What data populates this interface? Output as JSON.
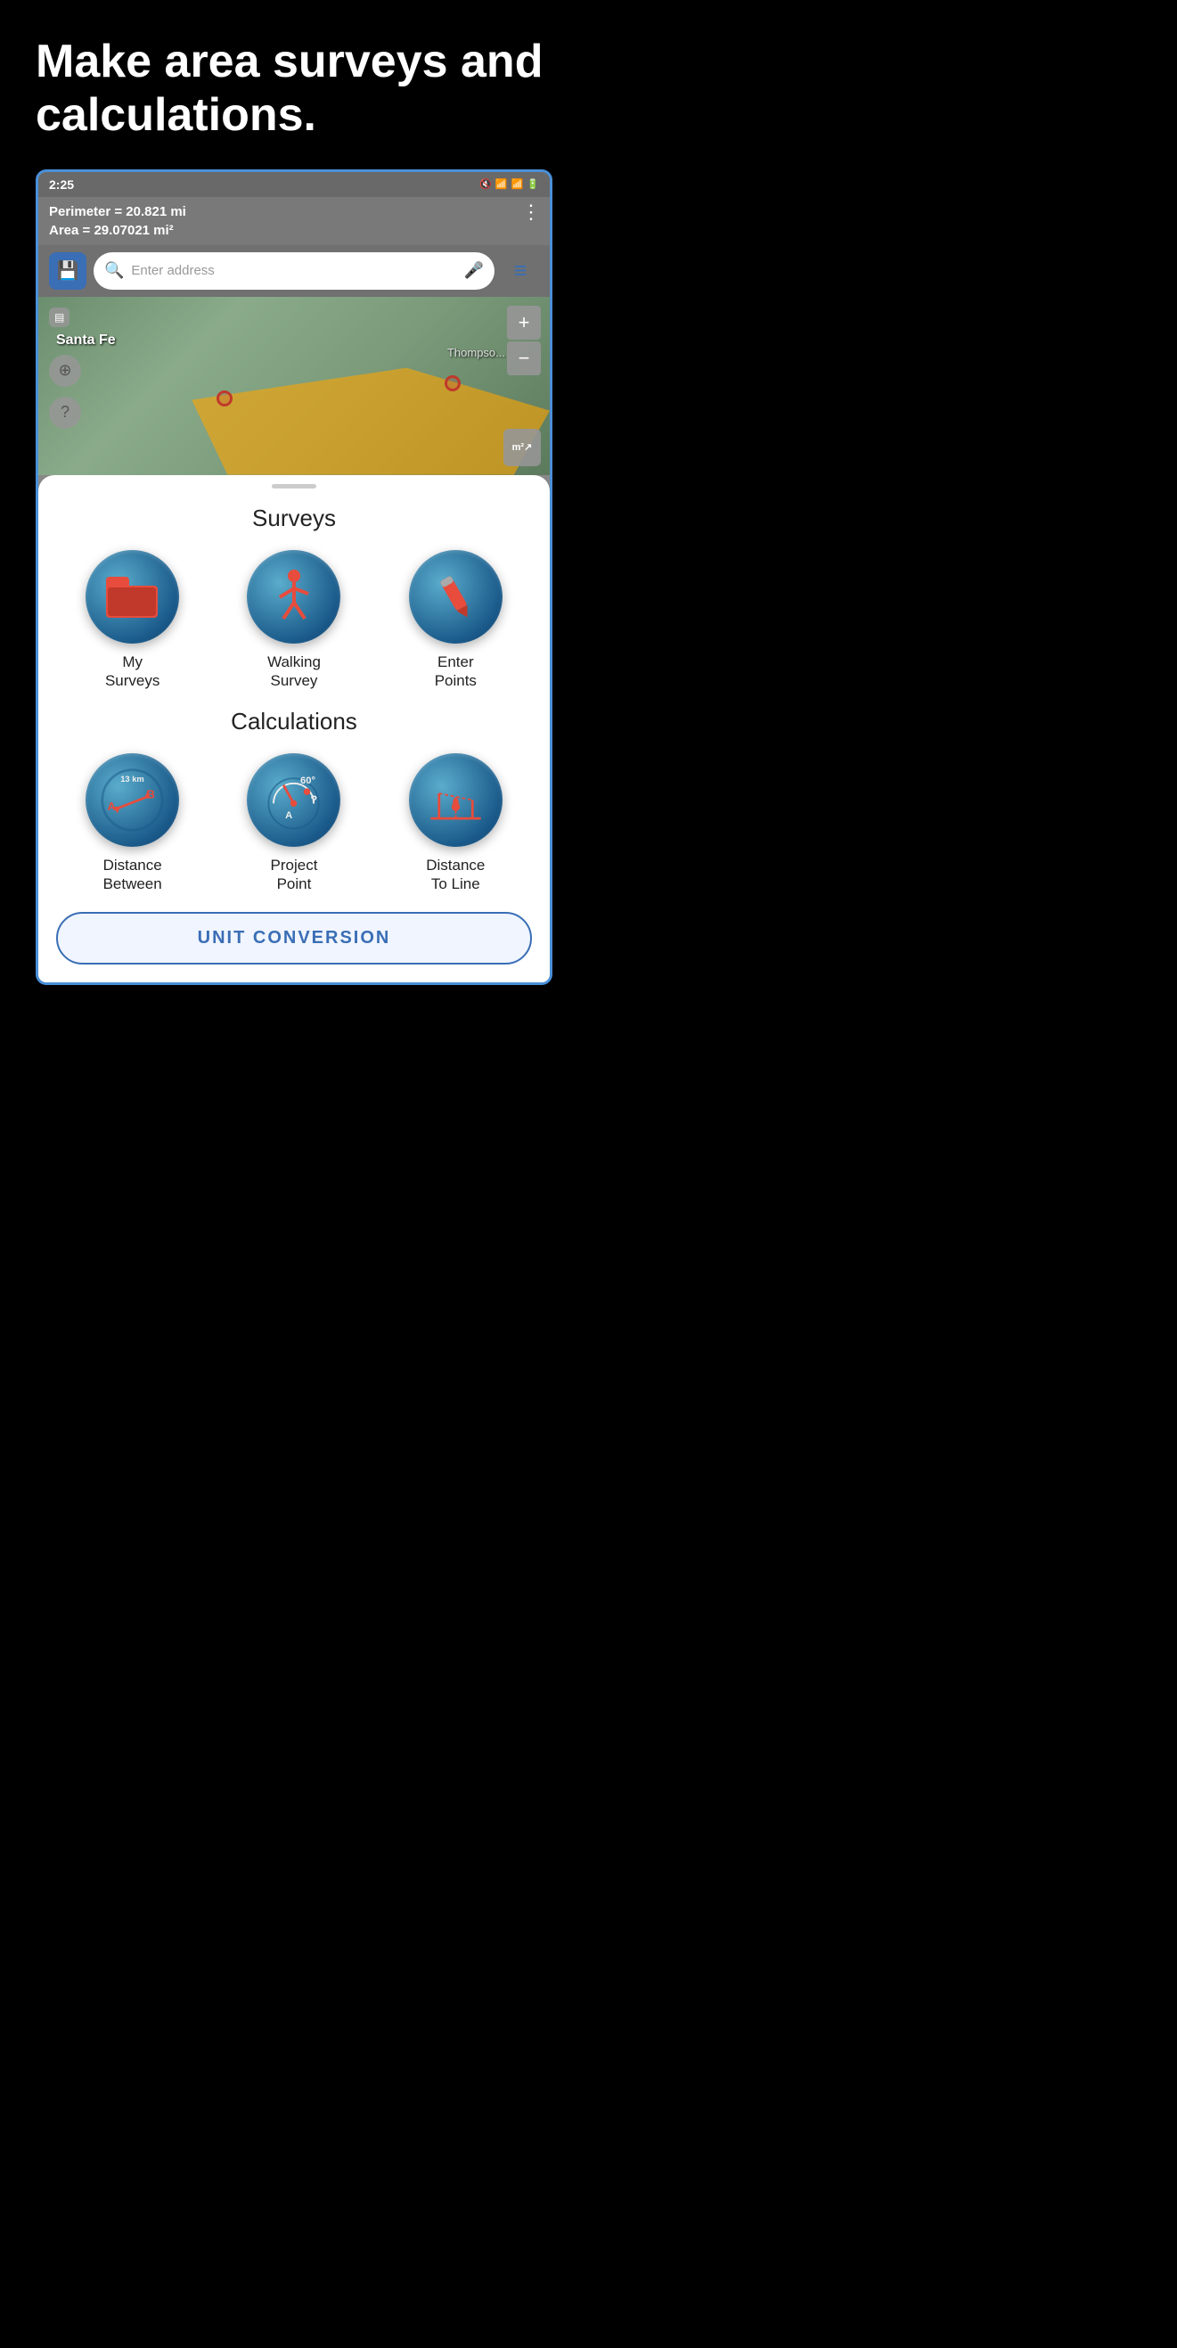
{
  "hero": {
    "title": "Make area surveys and calculations."
  },
  "status_bar": {
    "time": "2:25",
    "icons": "🔇 📶 📶 🔋"
  },
  "info_bar": {
    "perimeter": "Perimeter = 20.821 mi",
    "area": "Area = 29.07021 mi²",
    "more": "⋮"
  },
  "search_bar": {
    "save_icon": "💾",
    "placeholder": "Enter address",
    "mic_icon": "🎤",
    "menu_icon": "☰"
  },
  "map": {
    "label_santa_fe": "Santa Fe",
    "label_thompson": "Thompso...",
    "zoom_in": "+",
    "zoom_out": "−",
    "location_icon": "⊕",
    "help_icon": "?",
    "area_icon": "m²"
  },
  "bottom_sheet": {
    "handle": true,
    "surveys_title": "Surveys",
    "calculations_title": "Calculations",
    "surveys_buttons": [
      {
        "id": "my-surveys",
        "label": "My\nSurveys",
        "icon": "folder"
      },
      {
        "id": "walking-survey",
        "label": "Walking\nSurvey",
        "icon": "walk"
      },
      {
        "id": "enter-points",
        "label": "Enter\nPoints",
        "icon": "pencil"
      }
    ],
    "calc_buttons": [
      {
        "id": "distance-between",
        "label": "Distance\nBetween",
        "icon": "gauge-dist"
      },
      {
        "id": "project-point",
        "label": "Project\nPoint",
        "icon": "gauge-proj"
      },
      {
        "id": "distance-to-line",
        "label": "Distance\nTo Line",
        "icon": "gauge-line"
      }
    ],
    "unit_conversion": "UNIT CONVERSION"
  }
}
